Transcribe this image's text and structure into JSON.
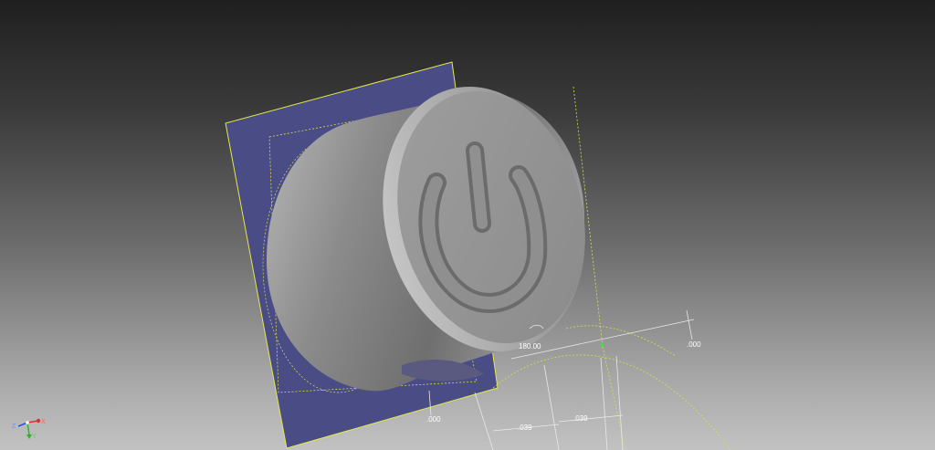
{
  "viewport": {
    "colors": {
      "background_top": "#1f1f1f",
      "background_bottom": "#c2c2c2",
      "sketch_plane": "#4a4c86",
      "sketch_plane_border": "#e4e84a",
      "sketch_lines": "#d8e048",
      "model_body": "#9a9a9a"
    }
  },
  "model": {
    "part": "power-button-knob",
    "icon": "power-symbol-icon"
  },
  "dimensions": {
    "angle": "180.00",
    "right_offset": ".000",
    "left_offset": ".000",
    "width_a": ".039",
    "width_b": ".039"
  },
  "view_cube": {
    "axes": [
      "X",
      "Y",
      "Z"
    ]
  }
}
